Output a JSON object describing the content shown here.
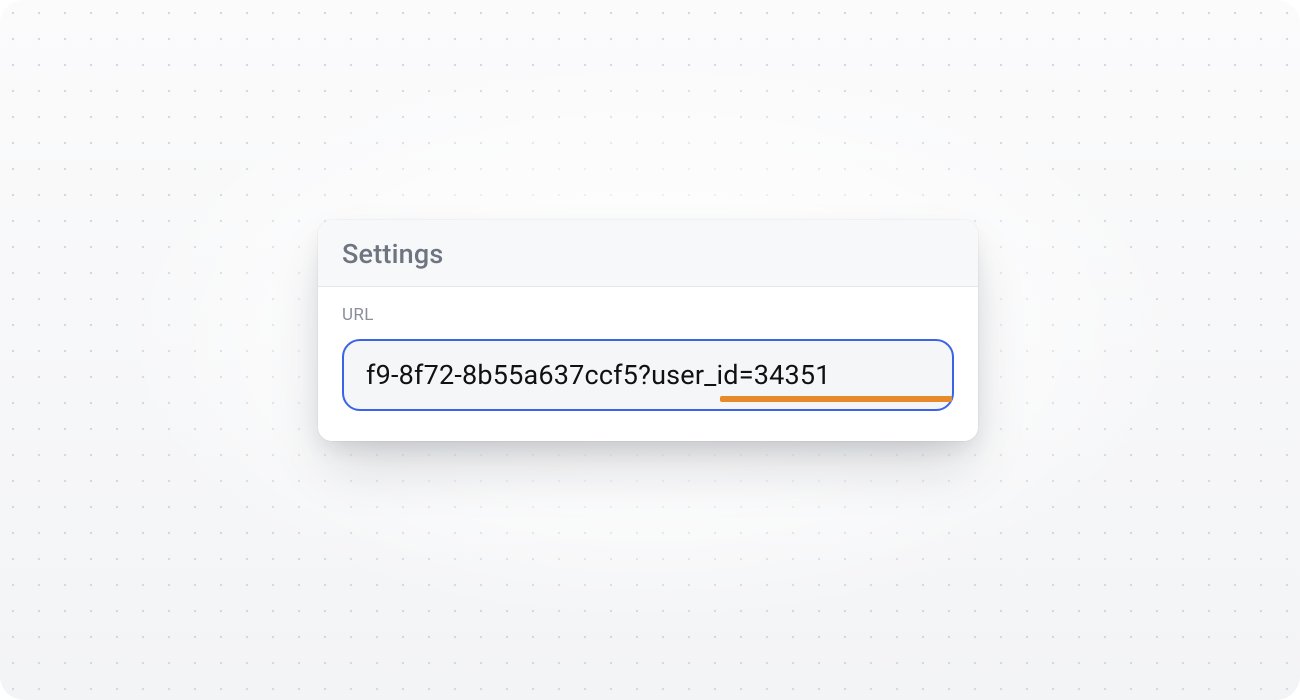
{
  "card": {
    "title": "Settings",
    "url_field": {
      "label": "URL",
      "value": "f9-8f72-8b55a637ccf5?user_id=34351",
      "highlighted_segment": "user_id=34351"
    }
  },
  "colors": {
    "focus_ring": "#3a63ea",
    "highlight_bar": "#e78a2a"
  }
}
